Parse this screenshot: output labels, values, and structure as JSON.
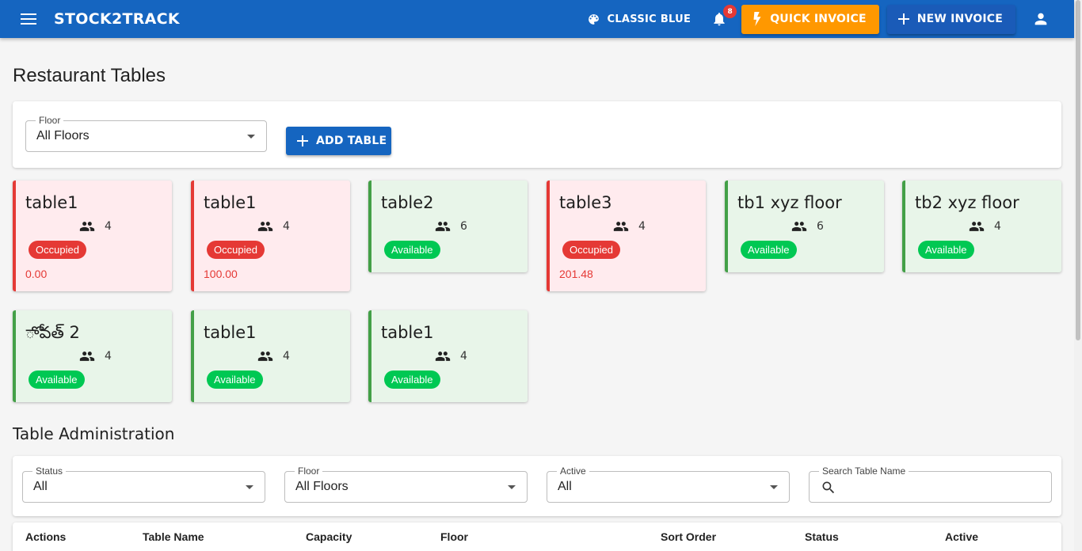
{
  "appbar": {
    "brand": "STOCK2TRACK",
    "theme_label": "CLASSIC BLUE",
    "notification_count": "8",
    "quick_invoice_label": "QUICK INVOICE",
    "new_invoice_label": "NEW INVOICE",
    "color": "#1565c0",
    "quick_color": "#ff9800"
  },
  "page": {
    "title": "Restaurant Tables"
  },
  "filter": {
    "floor_label": "Floor",
    "floor_value": "All Floors",
    "add_table_label": "ADD TABLE"
  },
  "tables": [
    {
      "name": "table1",
      "capacity": "4",
      "status": "Occupied",
      "amount": "0.00"
    },
    {
      "name": "table1",
      "capacity": "4",
      "status": "Occupied",
      "amount": "100.00"
    },
    {
      "name": "table2",
      "capacity": "6",
      "status": "Available"
    },
    {
      "name": "table3",
      "capacity": "4",
      "status": "Occupied",
      "amount": "201.48"
    },
    {
      "name": "tb1 xyz floor",
      "capacity": "6",
      "status": "Available"
    },
    {
      "name": "tb2 xyz floor",
      "capacity": "4",
      "status": "Available"
    },
    {
      "name": "ాోవత్ 2",
      "capacity": "4",
      "status": "Available"
    },
    {
      "name": "table1",
      "capacity": "4",
      "status": "Available"
    },
    {
      "name": "table1",
      "capacity": "4",
      "status": "Available"
    }
  ],
  "status_colors": {
    "occupied": "#e53935",
    "available": "#00c853"
  },
  "admin": {
    "title": "Table Administration",
    "status_label": "Status",
    "status_value": "All",
    "floor_label": "Floor",
    "floor_value": "All Floors",
    "active_label": "Active",
    "active_value": "All",
    "search_label": "Search Table Name",
    "columns": [
      "Actions",
      "Table Name",
      "Capacity",
      "Floor",
      "Sort Order",
      "Status",
      "Active"
    ]
  }
}
